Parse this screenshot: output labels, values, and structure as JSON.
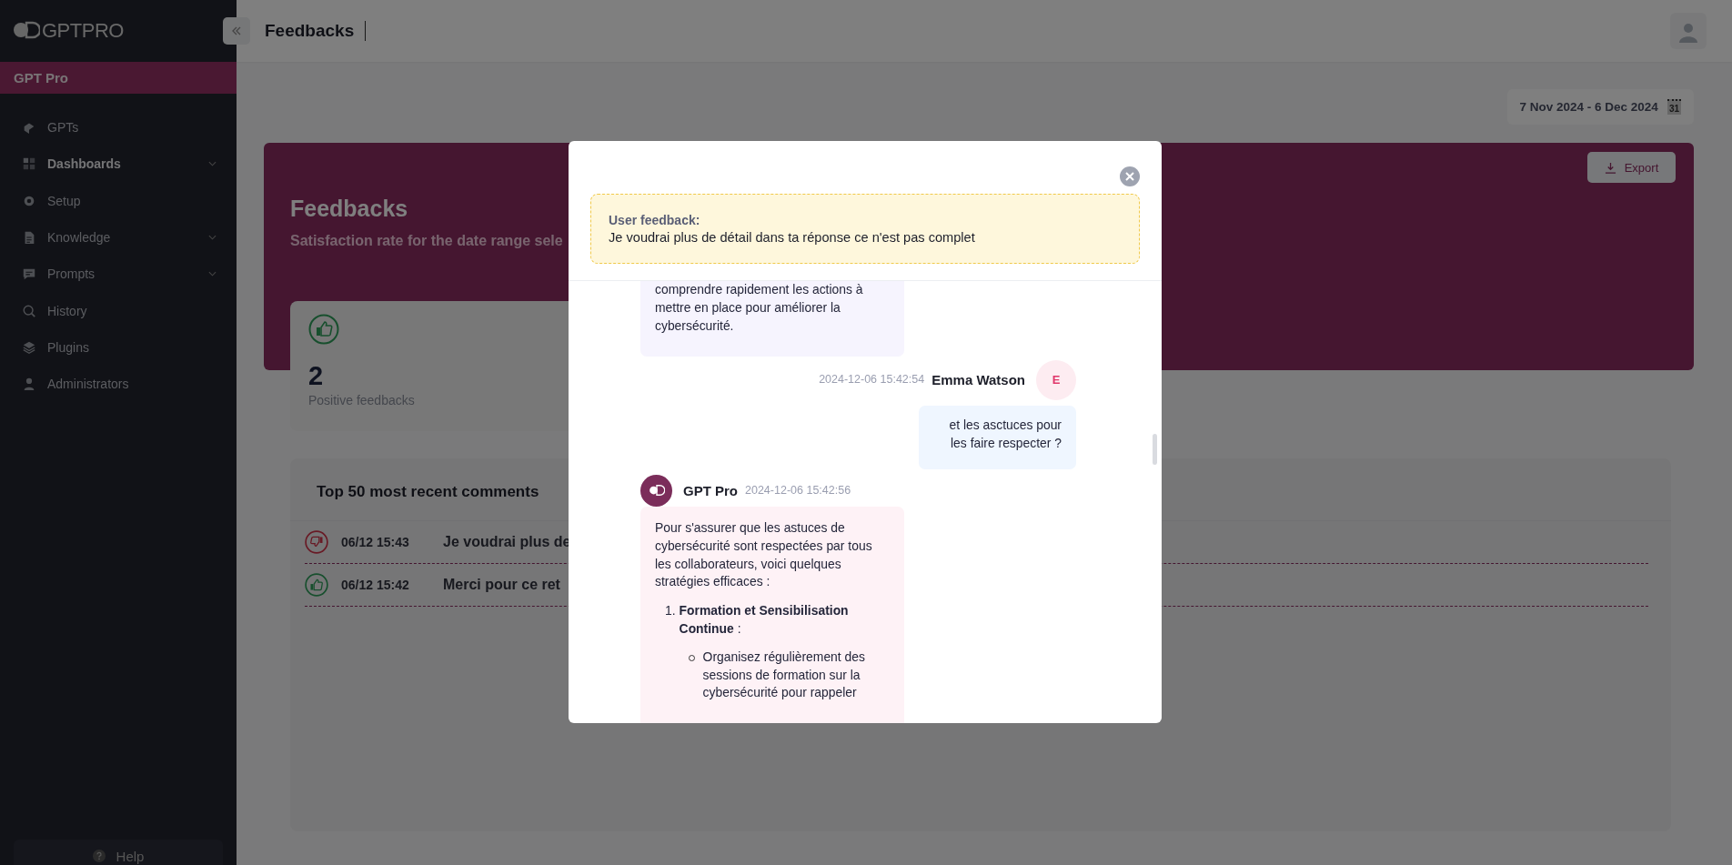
{
  "sidebar": {
    "logo": "GPTPRO",
    "workspace": "GPT Pro",
    "items": [
      {
        "label": "GPTs",
        "selected": false,
        "expandable": false
      },
      {
        "label": "Dashboards",
        "selected": true,
        "expandable": true
      },
      {
        "label": "Setup",
        "selected": false,
        "expandable": false
      },
      {
        "label": "Knowledge",
        "selected": false,
        "expandable": true
      },
      {
        "label": "Prompts",
        "selected": false,
        "expandable": true
      },
      {
        "label": "History",
        "selected": false,
        "expandable": false
      },
      {
        "label": "Plugins",
        "selected": false,
        "expandable": false
      },
      {
        "label": "Administrators",
        "selected": false,
        "expandable": false
      }
    ],
    "help": "Help"
  },
  "header": {
    "title": "Feedbacks"
  },
  "date_range": {
    "text": "7 Nov 2024 - 6 Dec 2024",
    "calendar_day": "31"
  },
  "banner": {
    "title": "Feedbacks",
    "subtitle": "Satisfaction rate for the date range sele",
    "export": "Export"
  },
  "stat": {
    "value": "2",
    "label": "Positive feedbacks"
  },
  "comments": {
    "title": "Top 50 most recent comments",
    "rows": [
      {
        "kind": "negative",
        "time": "06/12 15:43",
        "text": "Je voudrai plus de"
      },
      {
        "kind": "positive",
        "time": "06/12 15:42",
        "text": "Merci pour ce ret"
      }
    ]
  },
  "modal": {
    "feedback_label": "User feedback:",
    "feedback_text": "Je voudrai plus de détail dans ta réponse ce n'est pas complet",
    "messages": [
      {
        "kind": "assistant",
        "paragraphs": [
          "comprendre rapidement les actions à mettre en place pour améliorer la cybersécurité."
        ]
      },
      {
        "kind": "user",
        "author": "Emma Watson",
        "initial": "E",
        "time": "2024-12-06 15:42:54",
        "paragraphs": [
          "et les asctuces pour les faire respecter ?"
        ]
      },
      {
        "kind": "assistant",
        "author": "GPT Pro",
        "time": "2024-12-06 15:42:56",
        "paragraphs": [
          "Pour s'assurer que les astuces de cybersécurité sont respectées par tous les collaborateurs, voici quelques stratégies efficaces :"
        ],
        "list": [
          {
            "number": "1.",
            "title": "**Formation et Sensibilisation Continue** :",
            "points": [
              "Organisez régulièrement des sessions de formation sur la cybersécurité pour rappeler"
            ]
          }
        ]
      }
    ]
  }
}
